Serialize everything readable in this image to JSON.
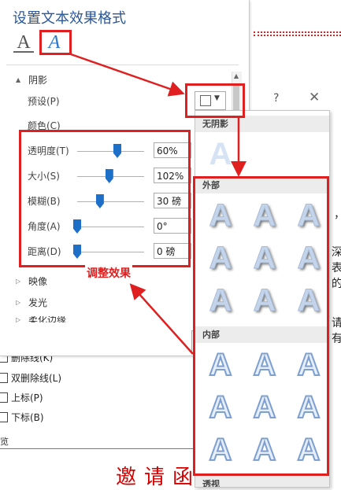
{
  "pane": {
    "title": "设置文本效果格式",
    "tab_fill_glyph": "A",
    "tab_effects_glyph": "A",
    "section_shadow": "阴影",
    "preset_label": "预设(P)",
    "color_label": "颜色(C)",
    "rows": [
      {
        "label": "透明度(T)",
        "value": "60%",
        "level": 0.6
      },
      {
        "label": "大小(S)",
        "value": "102%",
        "level": 0.48
      },
      {
        "label": "模糊(B)",
        "value": "30 磅",
        "level": 0.34
      },
      {
        "label": "角度(A)",
        "value": "0°",
        "level": 0.0
      },
      {
        "label": "距离(D)",
        "value": "0 磅",
        "level": 0.0
      }
    ],
    "section_reflection": "映像",
    "section_glow": "发光",
    "section_soft_edges": "柔化边缘",
    "annotation": "调整效果",
    "scroll_up_glyph": "▲",
    "expand_glyph": "▲",
    "collapse_glyph": "▷"
  },
  "gallery": {
    "no_shadow": "无阴影",
    "outer": "外部",
    "inner": "内部",
    "perspective": "透视",
    "glyph": "A",
    "question": "?",
    "close": "✕"
  },
  "document": {
    "options": [
      "删除线(K)",
      "双删除线(L)",
      "上标(P)",
      "下标(B)"
    ],
    "right_texts": [
      "，",
      "深",
      "表",
      "的",
      "请",
      "有"
    ],
    "invite": "邀请函",
    "preview_label": "览"
  },
  "colors": {
    "annotation_red": "#e02020",
    "accent_blue": "#2b5797",
    "slider_blue": "#1e6fc7"
  }
}
